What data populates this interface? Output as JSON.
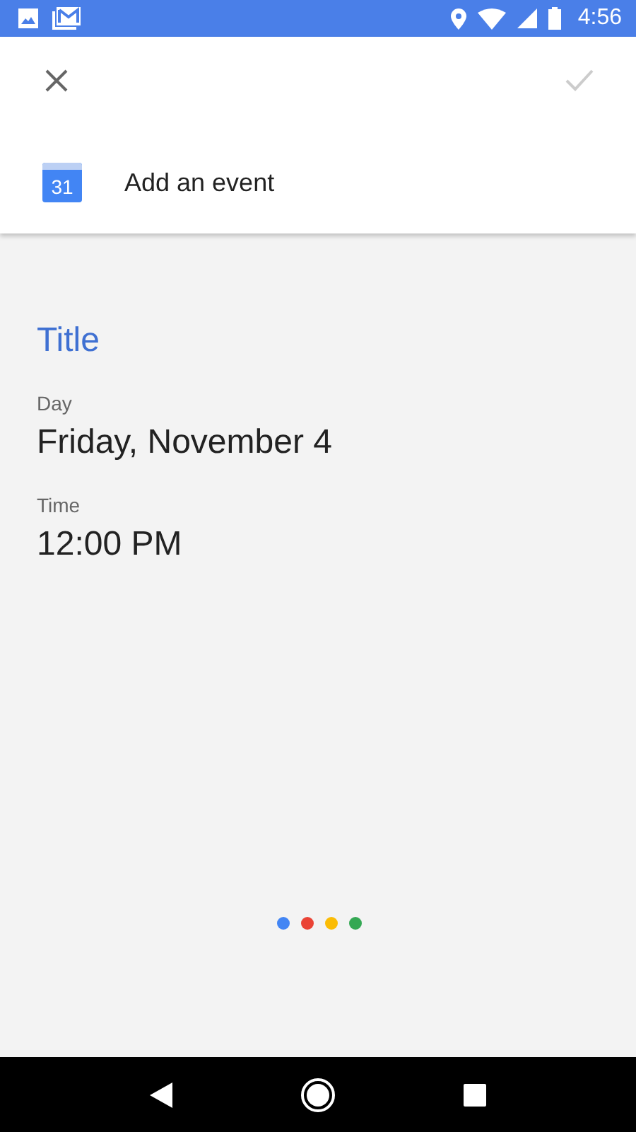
{
  "status_bar": {
    "time": "4:56"
  },
  "header": {
    "confirm_disabled": true,
    "app_title": "Add an event",
    "calendar_day": "31"
  },
  "form": {
    "title_placeholder": "Title",
    "fields": [
      {
        "label": "Day",
        "value": "Friday, November 4"
      },
      {
        "label": "Time",
        "value": "12:00 PM"
      }
    ]
  },
  "listening_dots": [
    {
      "color": "#4285f4"
    },
    {
      "color": "#ea4335"
    },
    {
      "color": "#fbbc05"
    },
    {
      "color": "#34a853"
    }
  ]
}
